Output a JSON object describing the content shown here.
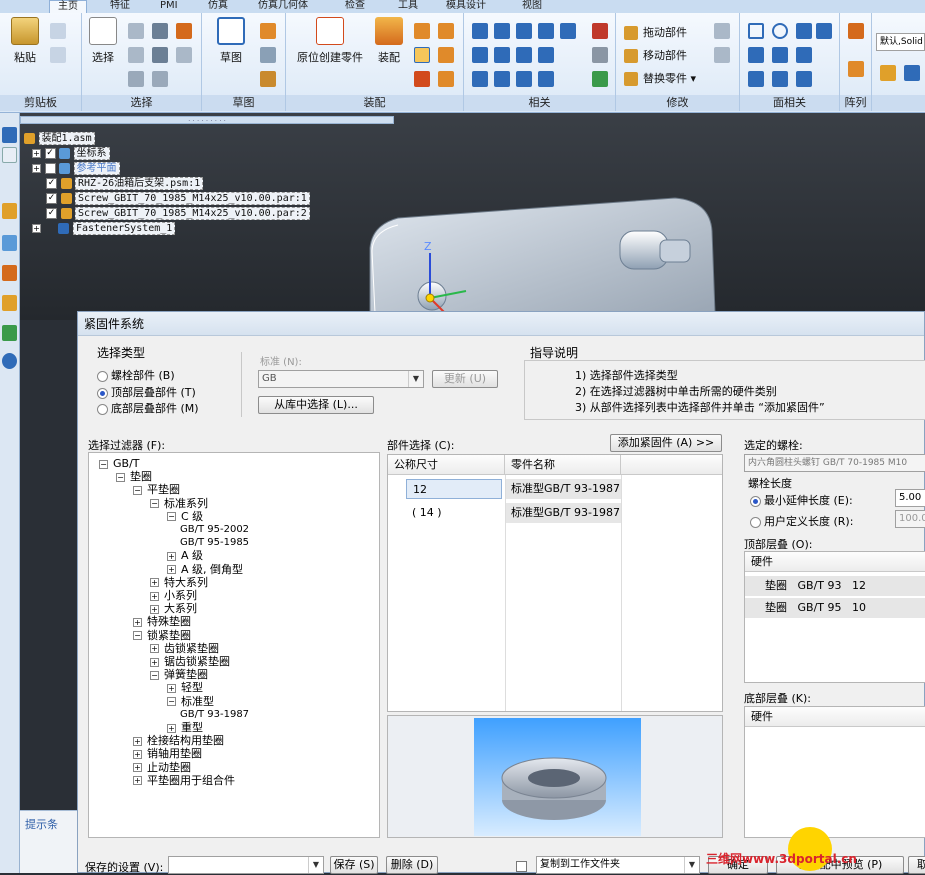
{
  "ribbon": {
    "tabs": [
      "主页",
      "特征",
      "PMI",
      "仿真",
      "仿真几何体",
      "检查",
      "工具",
      "模具设计",
      "视图"
    ],
    "groups": {
      "clipboard": {
        "label": "剪贴板",
        "paste": "粘贴"
      },
      "select": {
        "label": "选择",
        "select": "选择"
      },
      "sketch": {
        "label": "草图",
        "sketch": "草图"
      },
      "assemble": {
        "label": "装配",
        "create_in_place": "原位创建零件",
        "assemble": "装配"
      },
      "relate": {
        "label": "相关"
      },
      "modify": {
        "label": "修改",
        "drag": "拖动部件",
        "move": "移动部件",
        "replace": "替换零件"
      },
      "face_relate": {
        "label": "面相关"
      },
      "pattern": {
        "label": "阵列"
      },
      "style": {
        "value": "默认,Solid"
      }
    }
  },
  "tree": {
    "root": "装配1.asm",
    "items": [
      "坐标系",
      "参考平面",
      "RHZ-26油箱后支架.psm:1",
      "Screw_GBIT_70_1985_M14x25_v10.00.par:1",
      "Screw_GBIT_70_1985_M14x25_v10.00.par:2",
      "FastenerSystem_1"
    ]
  },
  "status": {
    "hint": "提示条"
  },
  "viewport": {
    "axis_z": "Z"
  },
  "dialog": {
    "title": "紧固件系统",
    "select_type": {
      "label": "选择类型",
      "options": [
        "螺栓部件 (B)",
        "顶部层叠部件 (T)",
        "底部层叠部件 (M)"
      ],
      "selected": 1
    },
    "standard": {
      "label": "标准 (N):",
      "value": "GB",
      "update": "更新 (U)",
      "from_library": "从库中选择 (L)..."
    },
    "guide": {
      "label": "指导说明",
      "lines": [
        "1) 选择部件选择类型",
        "2) 在选择过滤器树中单击所需的硬件类别",
        "3) 从部件选择列表中选择部件并单击 “添加紧固件”"
      ]
    },
    "filter": {
      "label": "选择过滤器 (F):",
      "nodes": [
        {
          "t": "GB/T",
          "d": 0,
          "p": "−"
        },
        {
          "t": "垫圈",
          "d": 1,
          "p": "−"
        },
        {
          "t": "平垫圈",
          "d": 2,
          "p": "−"
        },
        {
          "t": "标准系列",
          "d": 3,
          "p": "−"
        },
        {
          "t": "C 级",
          "d": 4,
          "p": "−"
        },
        {
          "t": "GB/T 95-2002",
          "d": 5,
          "p": ""
        },
        {
          "t": "GB/T 95-1985",
          "d": 5,
          "p": ""
        },
        {
          "t": "A 级",
          "d": 4,
          "p": "+"
        },
        {
          "t": "A 级, 倒角型",
          "d": 4,
          "p": "+"
        },
        {
          "t": "特大系列",
          "d": 3,
          "p": "+"
        },
        {
          "t": "小系列",
          "d": 3,
          "p": "+"
        },
        {
          "t": "大系列",
          "d": 3,
          "p": "+"
        },
        {
          "t": "特殊垫圈",
          "d": 2,
          "p": "+"
        },
        {
          "t": "锁紧垫圈",
          "d": 2,
          "p": "−"
        },
        {
          "t": "齿锁紧垫圈",
          "d": 3,
          "p": "+"
        },
        {
          "t": "锯齿锁紧垫圈",
          "d": 3,
          "p": "+"
        },
        {
          "t": "弹簧垫圈",
          "d": 3,
          "p": "−"
        },
        {
          "t": "轻型",
          "d": 4,
          "p": "+"
        },
        {
          "t": "标准型",
          "d": 4,
          "p": "−"
        },
        {
          "t": "GB/T 93-1987",
          "d": 5,
          "p": ""
        },
        {
          "t": "重型",
          "d": 4,
          "p": "+"
        },
        {
          "t": "栓接结构用垫圈",
          "d": 2,
          "p": "+"
        },
        {
          "t": "销轴用垫圈",
          "d": 2,
          "p": "+"
        },
        {
          "t": "止动垫圈",
          "d": 2,
          "p": "+"
        },
        {
          "t": "平垫圈用于组合件",
          "d": 2,
          "p": "+"
        }
      ]
    },
    "parts": {
      "label": "部件选择 (C):",
      "add_button": "添加紧固件 (A) >>",
      "columns": [
        "公称尺寸",
        "零件名称"
      ],
      "rows": [
        [
          "12",
          "标准型GB/T 93-1987"
        ],
        [
          "( 14 )",
          "标准型GB/T 93-1987"
        ]
      ]
    },
    "selected_bolt": {
      "label": "选定的螺栓:",
      "value": "内六角圆柱头螺钉 GB/T 70-1985 M10",
      "length_label": "螺栓长度",
      "min_ext": "最小延伸长度 (E):",
      "min_ext_value": "5.00",
      "user_def": "用户定义长度 (R):",
      "user_def_value": "100.0"
    },
    "top_stack": {
      "label": "顶部层叠 (O):",
      "header": "硬件",
      "rows": [
        [
          "垫圈",
          "GB/T 93",
          "12"
        ],
        [
          "垫圈",
          "GB/T 95",
          "10"
        ]
      ]
    },
    "bottom_stack": {
      "label": "底部层叠 (K):",
      "header": "硬件"
    },
    "footer": {
      "saved_label": "保存的设置 (V):",
      "save": "保存 (S)",
      "delete": "删除 (D)",
      "copy_label": "复制到工作文件夹",
      "ok": "确定",
      "preview": "在装配中预览 (P)",
      "cancel": "取消"
    }
  },
  "watermark": "三维网www.3dportal.cn"
}
